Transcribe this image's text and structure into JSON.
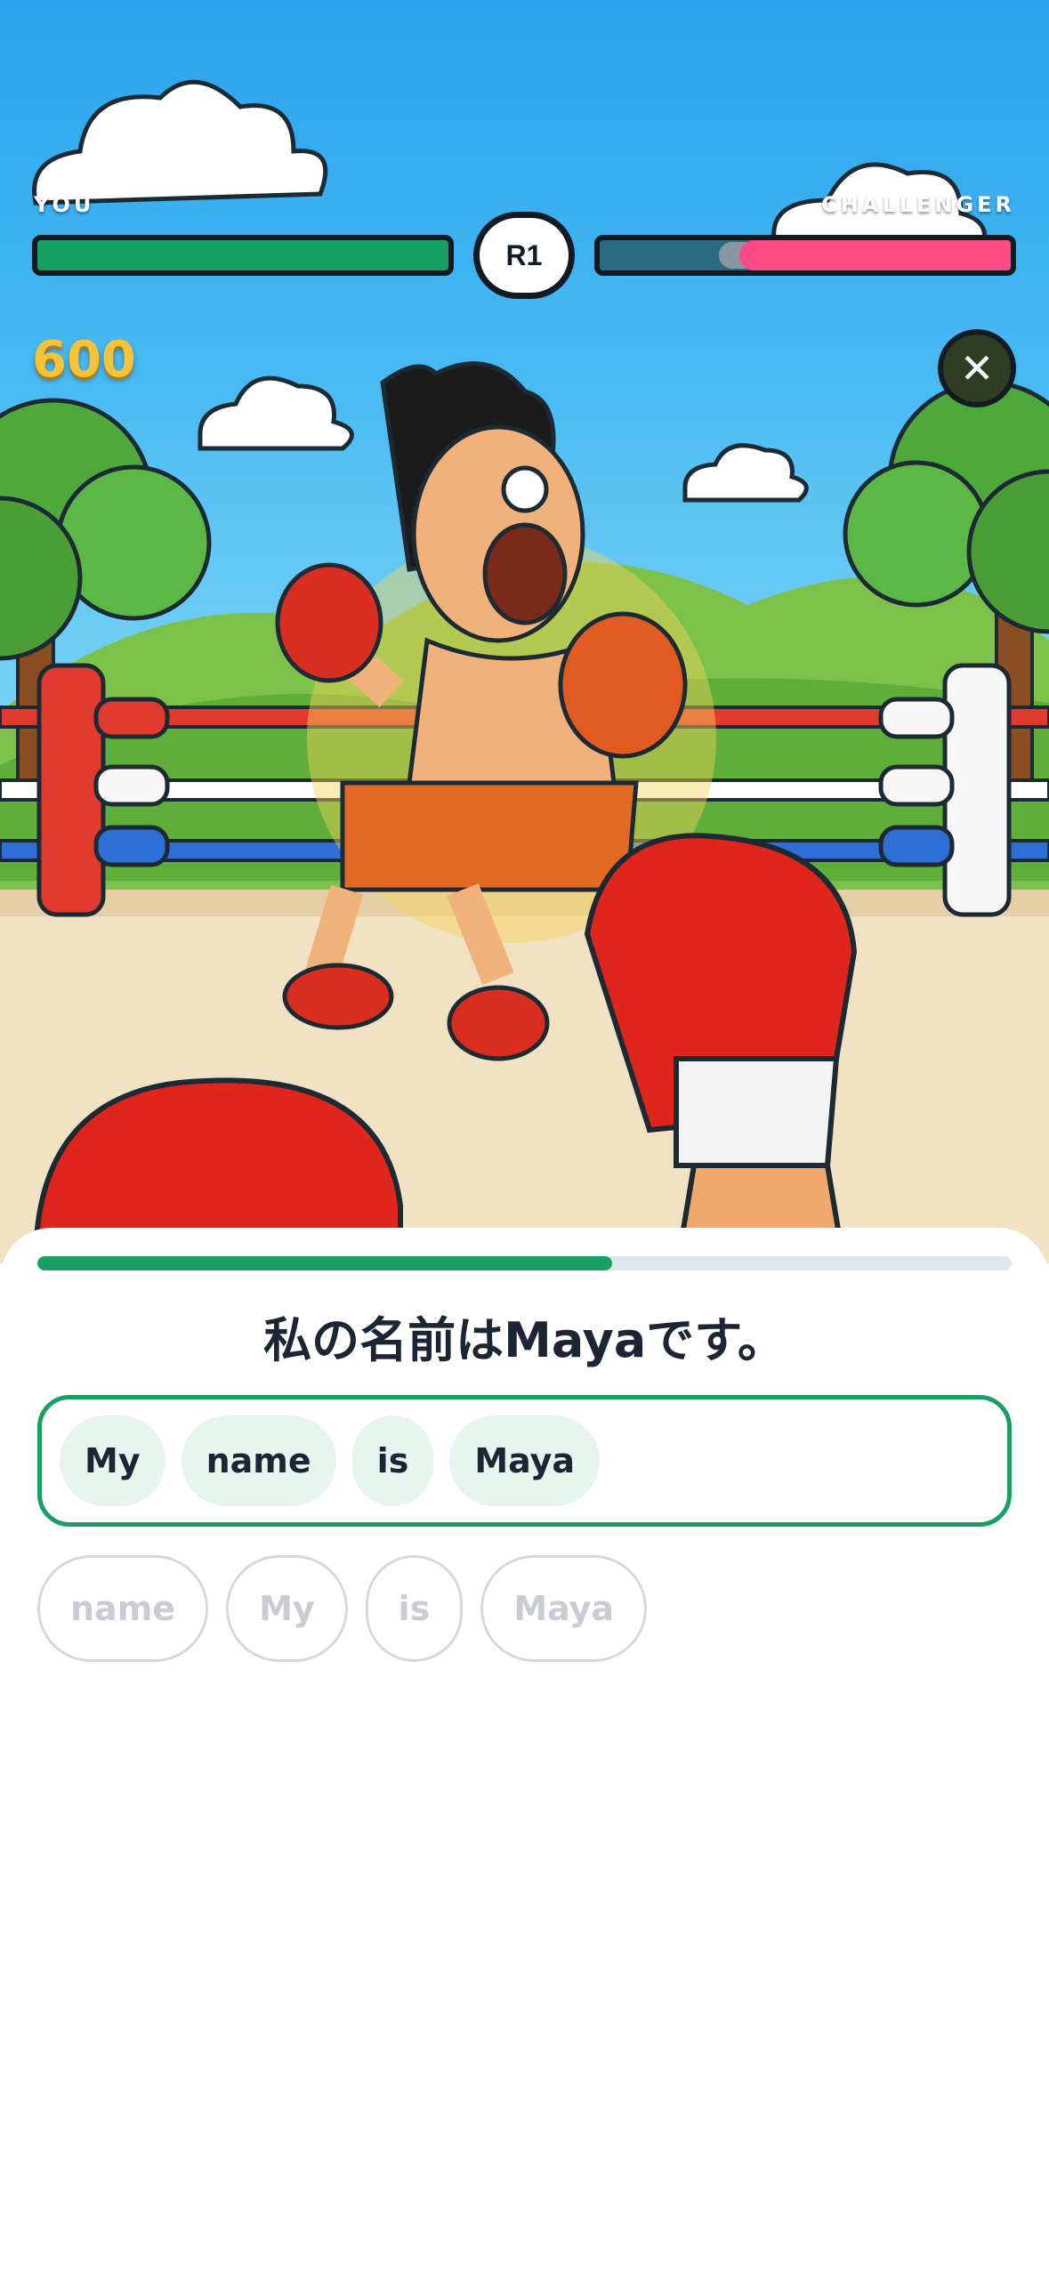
{
  "hud": {
    "player_label": "YOU",
    "opponent_label": "CHALLENGER",
    "round": "R1",
    "score": "600",
    "player_health": 1.0,
    "opponent_health": 0.66,
    "opponent_recent_damage": 0.05,
    "close_icon": "close-icon"
  },
  "colors": {
    "player_health": "#18a063",
    "opponent_health": "#ff4a86",
    "score": "#f6c23a",
    "accent": "#18a063"
  },
  "lesson": {
    "progress": 0.59,
    "prompt": "私の名前はMayaです。",
    "answer_chips": [
      "My",
      "name",
      "is",
      "Maya"
    ],
    "word_bank": [
      "name",
      "My",
      "is",
      "Maya"
    ]
  }
}
